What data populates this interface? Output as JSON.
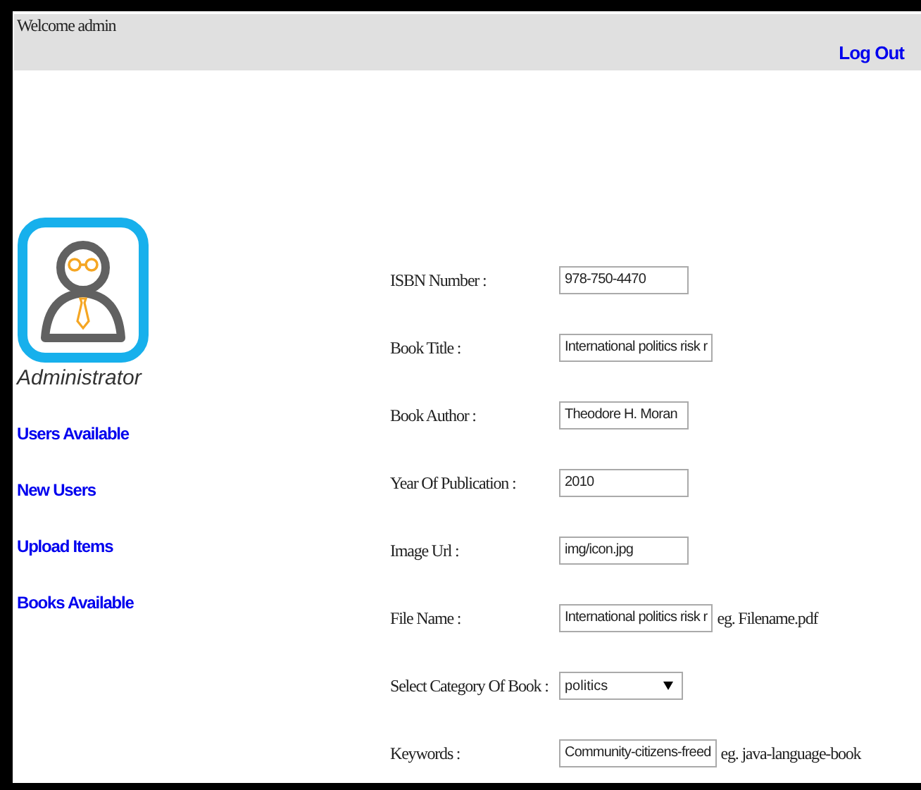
{
  "header": {
    "welcome": "Welcome admin",
    "logout": "Log Out"
  },
  "sidebar": {
    "role": "Administrator",
    "links": [
      "Users Available",
      "New Users",
      "Upload Items",
      "Books Available"
    ]
  },
  "form": {
    "fields": [
      {
        "kind": "text",
        "label": "ISBN Number :",
        "value": "978-750-4470"
      },
      {
        "kind": "text",
        "label": "Book Title :",
        "value": "International politics risk r"
      },
      {
        "kind": "text",
        "label": "Book Author :",
        "value": "Theodore H. Moran"
      },
      {
        "kind": "text",
        "label": "Year Of Publication :",
        "value": "2010"
      },
      {
        "kind": "text",
        "label": "Image Url :",
        "value": "img/icon.jpg"
      },
      {
        "kind": "text",
        "label": "File Name :",
        "value": "International politics risk r",
        "hint": "eg. Filename.pdf"
      },
      {
        "kind": "select",
        "label": "Select Category Of Book :",
        "value": "politics"
      },
      {
        "kind": "text",
        "label": "Keywords :",
        "value": "Community-citizens-freed",
        "hint": "eg. java-language-book"
      }
    ]
  }
}
